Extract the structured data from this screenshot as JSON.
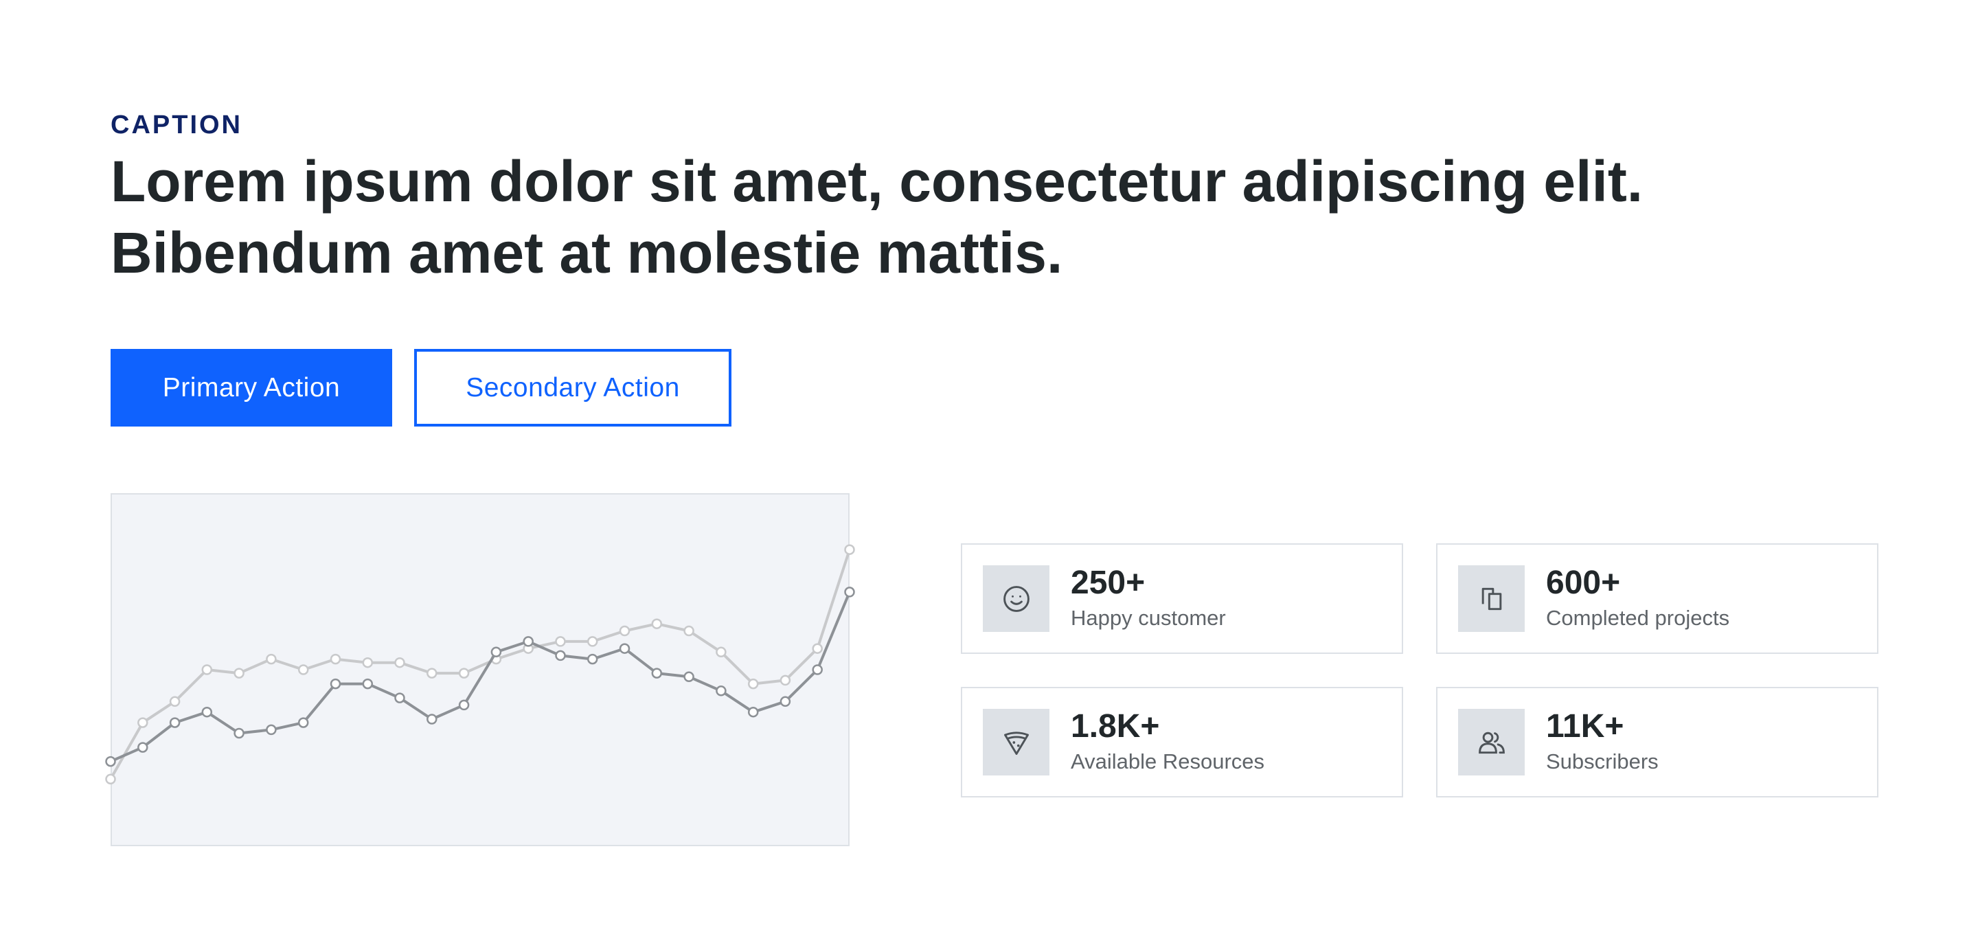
{
  "hero": {
    "caption": "CAPTION",
    "headline_line1": "Lorem ipsum dolor sit amet, consectetur adipiscing elit.",
    "headline_line2": "Bibendum amet at molestie mattis.",
    "primary_action_label": "Primary Action",
    "secondary_action_label": "Secondary Action"
  },
  "colors": {
    "accent": "#0f62fe",
    "caption": "#0f2366",
    "headline": "#21272a",
    "chart_background": "#f2f4f8",
    "series_dark": "#8d9196",
    "series_light": "#c8c9cb"
  },
  "chart_data": {
    "type": "line",
    "title": "",
    "xlabel": "",
    "ylabel": "",
    "grid": false,
    "legend": "none",
    "x": [
      0,
      1,
      2,
      3,
      4,
      5,
      6,
      7,
      8,
      9,
      10,
      11,
      12,
      13,
      14,
      15,
      16,
      17,
      18,
      19,
      20,
      21,
      22,
      23
    ],
    "xlim": [
      0,
      23
    ],
    "ylim": [
      0,
      100
    ],
    "series": [
      {
        "values": [
          24,
          28,
          35,
          38,
          32,
          33,
          35,
          46,
          46,
          42,
          36,
          40,
          55,
          58,
          54,
          53,
          56,
          49,
          48,
          44,
          38,
          41,
          50,
          72
        ]
      },
      {
        "values": [
          19,
          35,
          41,
          50,
          49,
          53,
          50,
          53,
          52,
          52,
          49,
          49,
          53,
          56,
          58,
          58,
          61,
          63,
          61,
          55,
          46,
          47,
          56,
          84
        ]
      }
    ]
  },
  "stats": [
    {
      "value": "250+",
      "label": "Happy customer",
      "icon": "smiley-icon"
    },
    {
      "value": "600+",
      "label": "Completed projects",
      "icon": "copy-icon"
    },
    {
      "value": "1.8K+",
      "label": "Available Resources",
      "icon": "pizza-icon"
    },
    {
      "value": "11K+",
      "label": "Subscribers",
      "icon": "users-icon"
    }
  ]
}
